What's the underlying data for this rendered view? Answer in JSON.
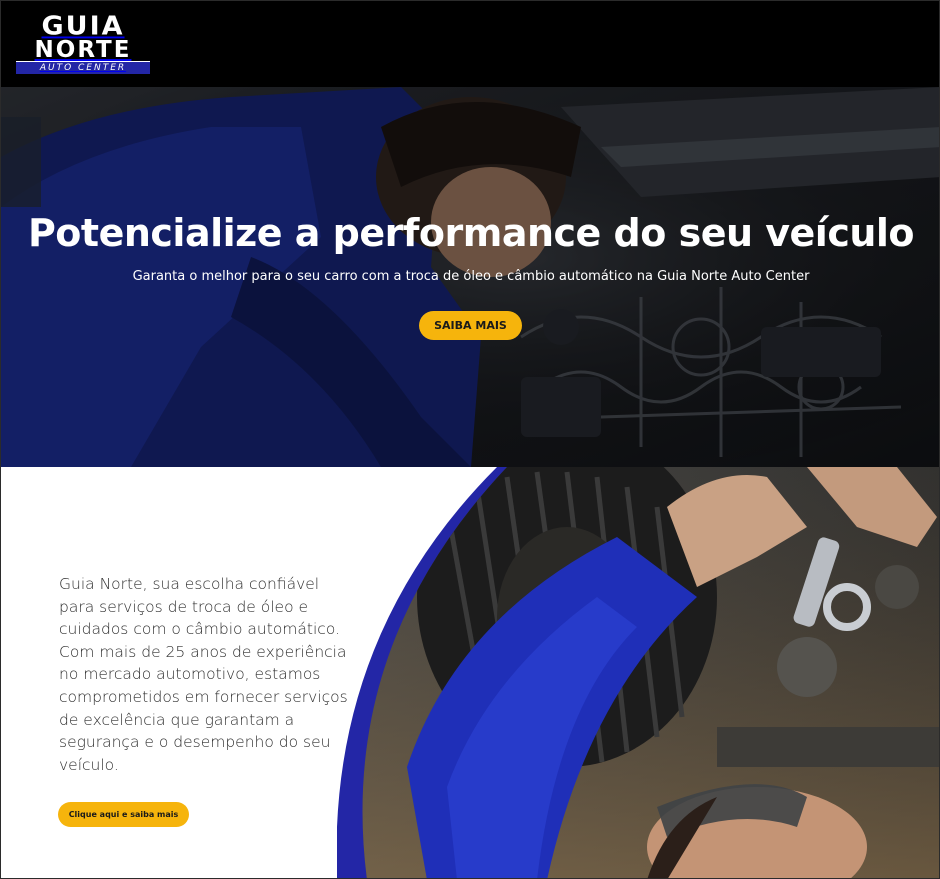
{
  "header": {
    "logo": {
      "line1": "GUIA",
      "line2": "NORTE",
      "strip": "AUTO CENTER"
    }
  },
  "hero": {
    "title": "Potencialize a performance do seu veículo",
    "subtitle": "Garanta o melhor para o seu carro com a troca de óleo e câmbio automático na Guia Norte Auto Center",
    "button_label": "SAIBA MAIS"
  },
  "about": {
    "paragraph": "Guia Norte, sua escolha confiável para serviços de troca de óleo e cuidados com o câmbio automático. Com mais de 25 anos de experiência no mercado automotivo, estamos comprometidos em fornecer serviços de excelência que garantam a segurança e o desempenho do seu veículo.",
    "button_label": "Clique aqui e saiba mais"
  },
  "colors": {
    "header_bg": "#000000",
    "accent_button": "#f6b40c",
    "brand_blue": "#2326a6",
    "text_dark": "#2e2e2e"
  }
}
